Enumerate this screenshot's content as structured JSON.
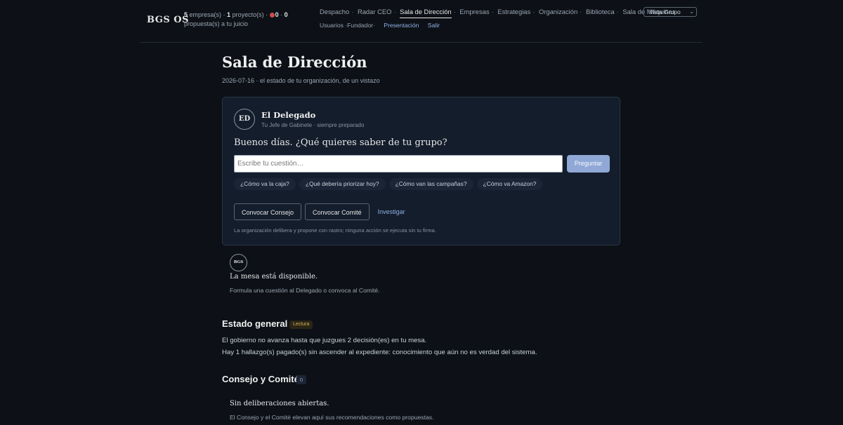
{
  "header": {
    "logo": "BGS OS",
    "stats": {
      "empresas_count": "5",
      "empresas_label": "empresa(s)",
      "proyectos_count": "1",
      "proyectos_label": "proyecto(s)",
      "alerts_count": "0",
      "propuestas_count": "0",
      "propuestas_label": "propuesta(s) a tu juicio"
    },
    "nav": [
      "Despacho",
      "Radar CEO",
      "Sala de Dirección",
      "Empresas",
      "Estrategias",
      "Organización",
      "Biblioteca",
      "Sala de Máquinas"
    ],
    "active_nav": "Sala de Dirección",
    "view_select": "Vista Grupo",
    "nav2": {
      "usuarios": "Usuarios",
      "role": "Fundador",
      "presentacion": "Presentación",
      "salir": "Salir"
    }
  },
  "page": {
    "title": "Sala de Dirección",
    "date": "2026-07-16",
    "subtitle": "el estado de tu organización, de un vistazo"
  },
  "delegado": {
    "initials": "ED",
    "name": "El Delegado",
    "role": "Tu Jefe de Gabinete · siempre preparado",
    "greeting": "Buenos días. ¿Qué quieres saber de tu grupo?",
    "input_placeholder": "Escribe tu cuestión…",
    "ask_button": "Preguntar",
    "suggestions": [
      "¿Cómo va la caja?",
      "¿Qué debería priorizar hoy?",
      "¿Cómo van las campañas?",
      "¿Cómo va Amazon?"
    ],
    "convocar_consejo": "Convocar Consejo",
    "convocar_comite": "Convocar Comité",
    "investigar": "Investigar",
    "footnote": "La organización delibera y propone con rastro; ninguna acción se ejecuta sin tu firma."
  },
  "mesa": {
    "badge": "BGS",
    "title": "La mesa está disponible.",
    "subtitle": "Formula una cuestión al Delegado o convoca al Comité."
  },
  "estado": {
    "heading": "Estado general",
    "badge": "Lectura",
    "line1": "El gobierno no avanza hasta que juzgues 2 decisión(es) en tu mesa.",
    "line2": "Hay 1 hallazgo(s) pagado(s) sin ascender al expediente: conocimiento que aún no es verdad del sistema."
  },
  "consejo": {
    "heading": "Consejo y Comité",
    "count": "0",
    "empty_title": "Sin deliberaciones abiertas.",
    "empty_sub": "El Consejo y el Comité elevan aquí sus recomendaciones como propuestas."
  }
}
